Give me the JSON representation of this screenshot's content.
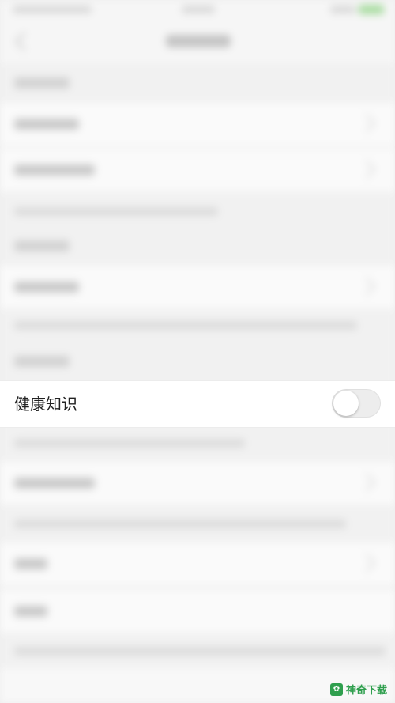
{
  "settings": {
    "health_knowledge_label": "健康知识",
    "health_knowledge_enabled": false
  },
  "watermark": {
    "text": "神奇下载",
    "color": "#2f9f4e"
  },
  "colors": {
    "row_background": "#ffffff",
    "toggle_off": "#ededed"
  }
}
